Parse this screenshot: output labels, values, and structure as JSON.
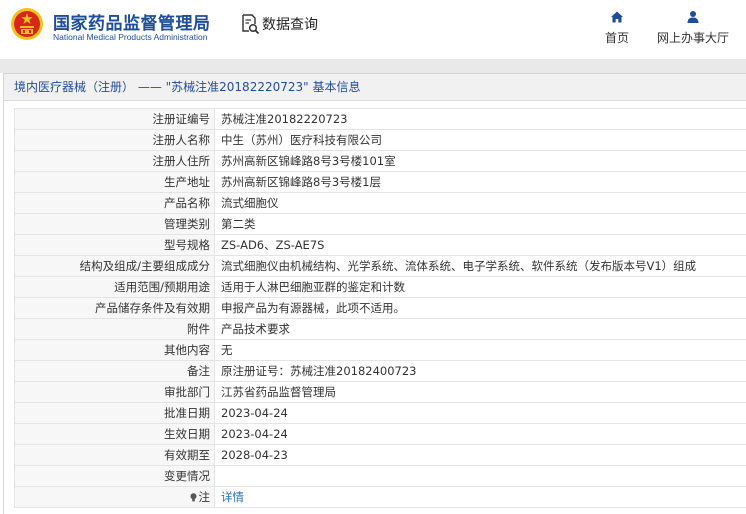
{
  "header": {
    "org_name_cn": "国家药品监督管理局",
    "org_name_en": "National Medical Products Administration",
    "query_label": "数据查询",
    "nav": {
      "home": "首页",
      "online_hall": "网上办事大厅"
    },
    "colors": {
      "brand": "#1f4e99",
      "emblem_red": "#d7271c",
      "emblem_gold": "#f3c21b"
    }
  },
  "panel": {
    "title": "境内医疗器械（注册） —— \"苏械注准20182220723\" 基本信息"
  },
  "rows": [
    {
      "key": "注册证编号",
      "value": "苏械注准20182220723"
    },
    {
      "key": "注册人名称",
      "value": "中生（苏州）医疗科技有限公司"
    },
    {
      "key": "注册人住所",
      "value": "苏州高新区锦峰路8号3号楼101室"
    },
    {
      "key": "生产地址",
      "value": "苏州高新区锦峰路8号3号楼1层"
    },
    {
      "key": "产品名称",
      "value": "流式细胞仪"
    },
    {
      "key": "管理类别",
      "value": "第二类"
    },
    {
      "key": "型号规格",
      "value": "ZS-AD6、ZS-AE7S"
    },
    {
      "key": "结构及组成/主要组成成分",
      "value": "流式细胞仪由机械结构、光学系统、流体系统、电子学系统、软件系统（发布版本号V1）组成"
    },
    {
      "key": "适用范围/预期用途",
      "value": "适用于人淋巴细胞亚群的鉴定和计数"
    },
    {
      "key": "产品储存条件及有效期",
      "value": "申报产品为有源器械，此项不适用。"
    },
    {
      "key": "附件",
      "value": "产品技术要求"
    },
    {
      "key": "其他内容",
      "value": "无"
    },
    {
      "key": "备注",
      "value": "原注册证号：苏械注准20182400723"
    },
    {
      "key": "审批部门",
      "value": "江苏省药品监督管理局"
    },
    {
      "key": "批准日期",
      "value": "2023-04-24"
    },
    {
      "key": "生效日期",
      "value": "2023-04-24"
    },
    {
      "key": "有效期至",
      "value": "2028-04-23"
    },
    {
      "key": "变更情况",
      "value": ""
    }
  ],
  "note_row": {
    "key": "注",
    "icon": "lightbulb-icon",
    "link": "详情"
  }
}
